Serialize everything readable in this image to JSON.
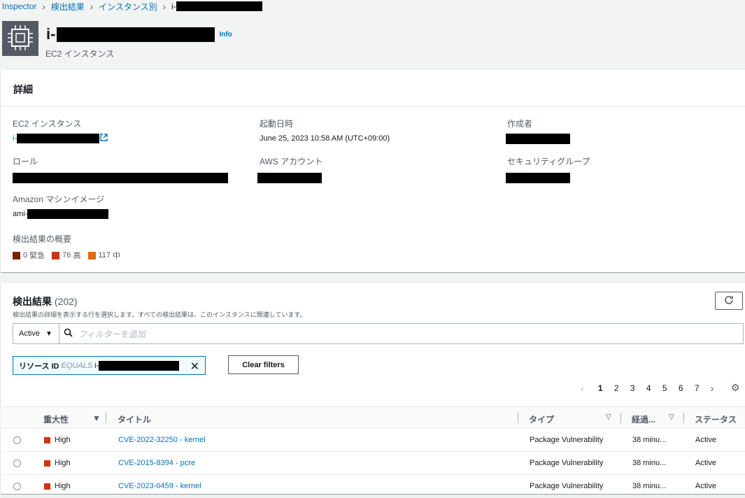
{
  "breadcrumb": {
    "items": [
      "Inspector",
      "検出結果",
      "インスタンス別"
    ],
    "current_prefix": "i-"
  },
  "header": {
    "title_prefix": "i-",
    "info": "Info",
    "subtitle": "EC2 インスタンス"
  },
  "details": {
    "title": "詳細",
    "ec2_label": "EC2 インスタンス",
    "ec2_prefix": "i-",
    "launch_label": "起動日時",
    "launch_value": "June 25, 2023 10:58 AM (UTC+09:00)",
    "creator_label": "作成者",
    "role_label": "ロール",
    "account_label": "AWS アカウント",
    "sg_label": "セキュリティグループ",
    "ami_label": "Amazon マシンイメージ",
    "ami_prefix": "ami-",
    "summary_label": "検出結果の概要",
    "summary": [
      {
        "count": "0",
        "label": "緊急",
        "color": "#7d2105"
      },
      {
        "count": "76",
        "label": "高",
        "color": "#d13212"
      },
      {
        "count": "117",
        "label": "中",
        "color": "#dd6b10"
      }
    ]
  },
  "findings": {
    "title": "検出結果",
    "count": "(202)",
    "description": "検出結果の詳細を表示する行を選択します。すべての検出結果は、このインスタンスに関連しています。",
    "status_select": "Active",
    "filter_placeholder": "フィルターを追加",
    "token_key": "リソース ID",
    "token_op": "EQUALS",
    "token_value_prefix": "i-",
    "clear_filters": "Clear filters",
    "pages": [
      "1",
      "2",
      "3",
      "4",
      "5",
      "6",
      "7"
    ],
    "columns": {
      "severity": "重大性",
      "title": "タイトル",
      "type": "タイプ",
      "age": "経過...",
      "status": "ステータス"
    },
    "rows": [
      {
        "severity": "High",
        "title": "CVE-2022-32250 - kernel",
        "type": "Package Vulnerability",
        "age": "38 minu...",
        "status": "Active"
      },
      {
        "severity": "High",
        "title": "CVE-2015-8394 - pcre",
        "type": "Package Vulnerability",
        "age": "38 minu...",
        "status": "Active"
      },
      {
        "severity": "High",
        "title": "CVE-2023-0459 - kernel",
        "type": "Package Vulnerability",
        "age": "38 minu...",
        "status": "Active"
      }
    ]
  },
  "colors": {
    "link": "#0073bb",
    "high": "#d13212",
    "token_border": "#0073bb"
  }
}
